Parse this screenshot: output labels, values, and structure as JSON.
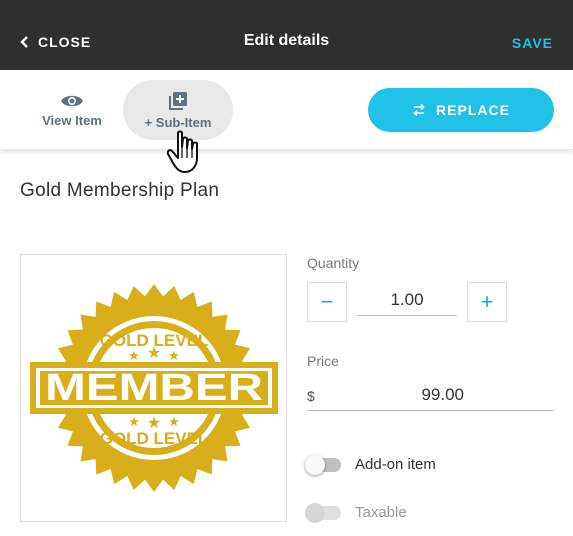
{
  "header": {
    "close_label": "CLOSE",
    "title": "Edit details",
    "save_label": "SAVE"
  },
  "toolbar": {
    "view_item_label": "View Item",
    "sub_item_label": "+ Sub-Item",
    "replace_label": "REPLACE"
  },
  "item": {
    "title": "Gold Membership Plan",
    "image": {
      "badge_top_text": "GOLD LEVEL",
      "badge_main_text": "MEMBER",
      "badge_bottom_text": "GOLD LEVEL"
    }
  },
  "quantity": {
    "label": "Quantity",
    "minus": "−",
    "plus": "+",
    "value": "1.00"
  },
  "price": {
    "label": "Price",
    "currency": "$",
    "value": "99.00"
  },
  "toggles": {
    "addon_label": "Add-on item",
    "addon_on": false,
    "taxable_label": "Taxable",
    "taxable_on": false
  },
  "colors": {
    "header_bg": "#2f2f2f",
    "accent": "#20c2e8",
    "badge_gold": "#d9ae1b"
  }
}
